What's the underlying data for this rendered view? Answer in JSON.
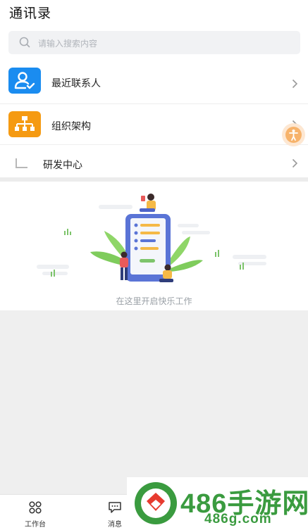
{
  "header": {
    "title": "通讯录"
  },
  "search": {
    "placeholder": "请输入搜索内容"
  },
  "list": [
    {
      "label": "最近联系人",
      "icon": "recent-contacts-icon",
      "color": "#1a8cf0"
    },
    {
      "label": "组织架构",
      "icon": "org-chart-icon",
      "color": "#f59a12"
    },
    {
      "label": "研发中心",
      "icon": "tree-branch-icon"
    }
  ],
  "empty": {
    "text": "在这里开启快乐工作"
  },
  "tabbar": [
    {
      "label": "工作台",
      "icon": "workbench-icon"
    },
    {
      "label": "消息",
      "icon": "message-icon"
    }
  ],
  "watermark": {
    "brand": "486手游网",
    "domain": "486g.com",
    "color": "#3a9b3f"
  }
}
